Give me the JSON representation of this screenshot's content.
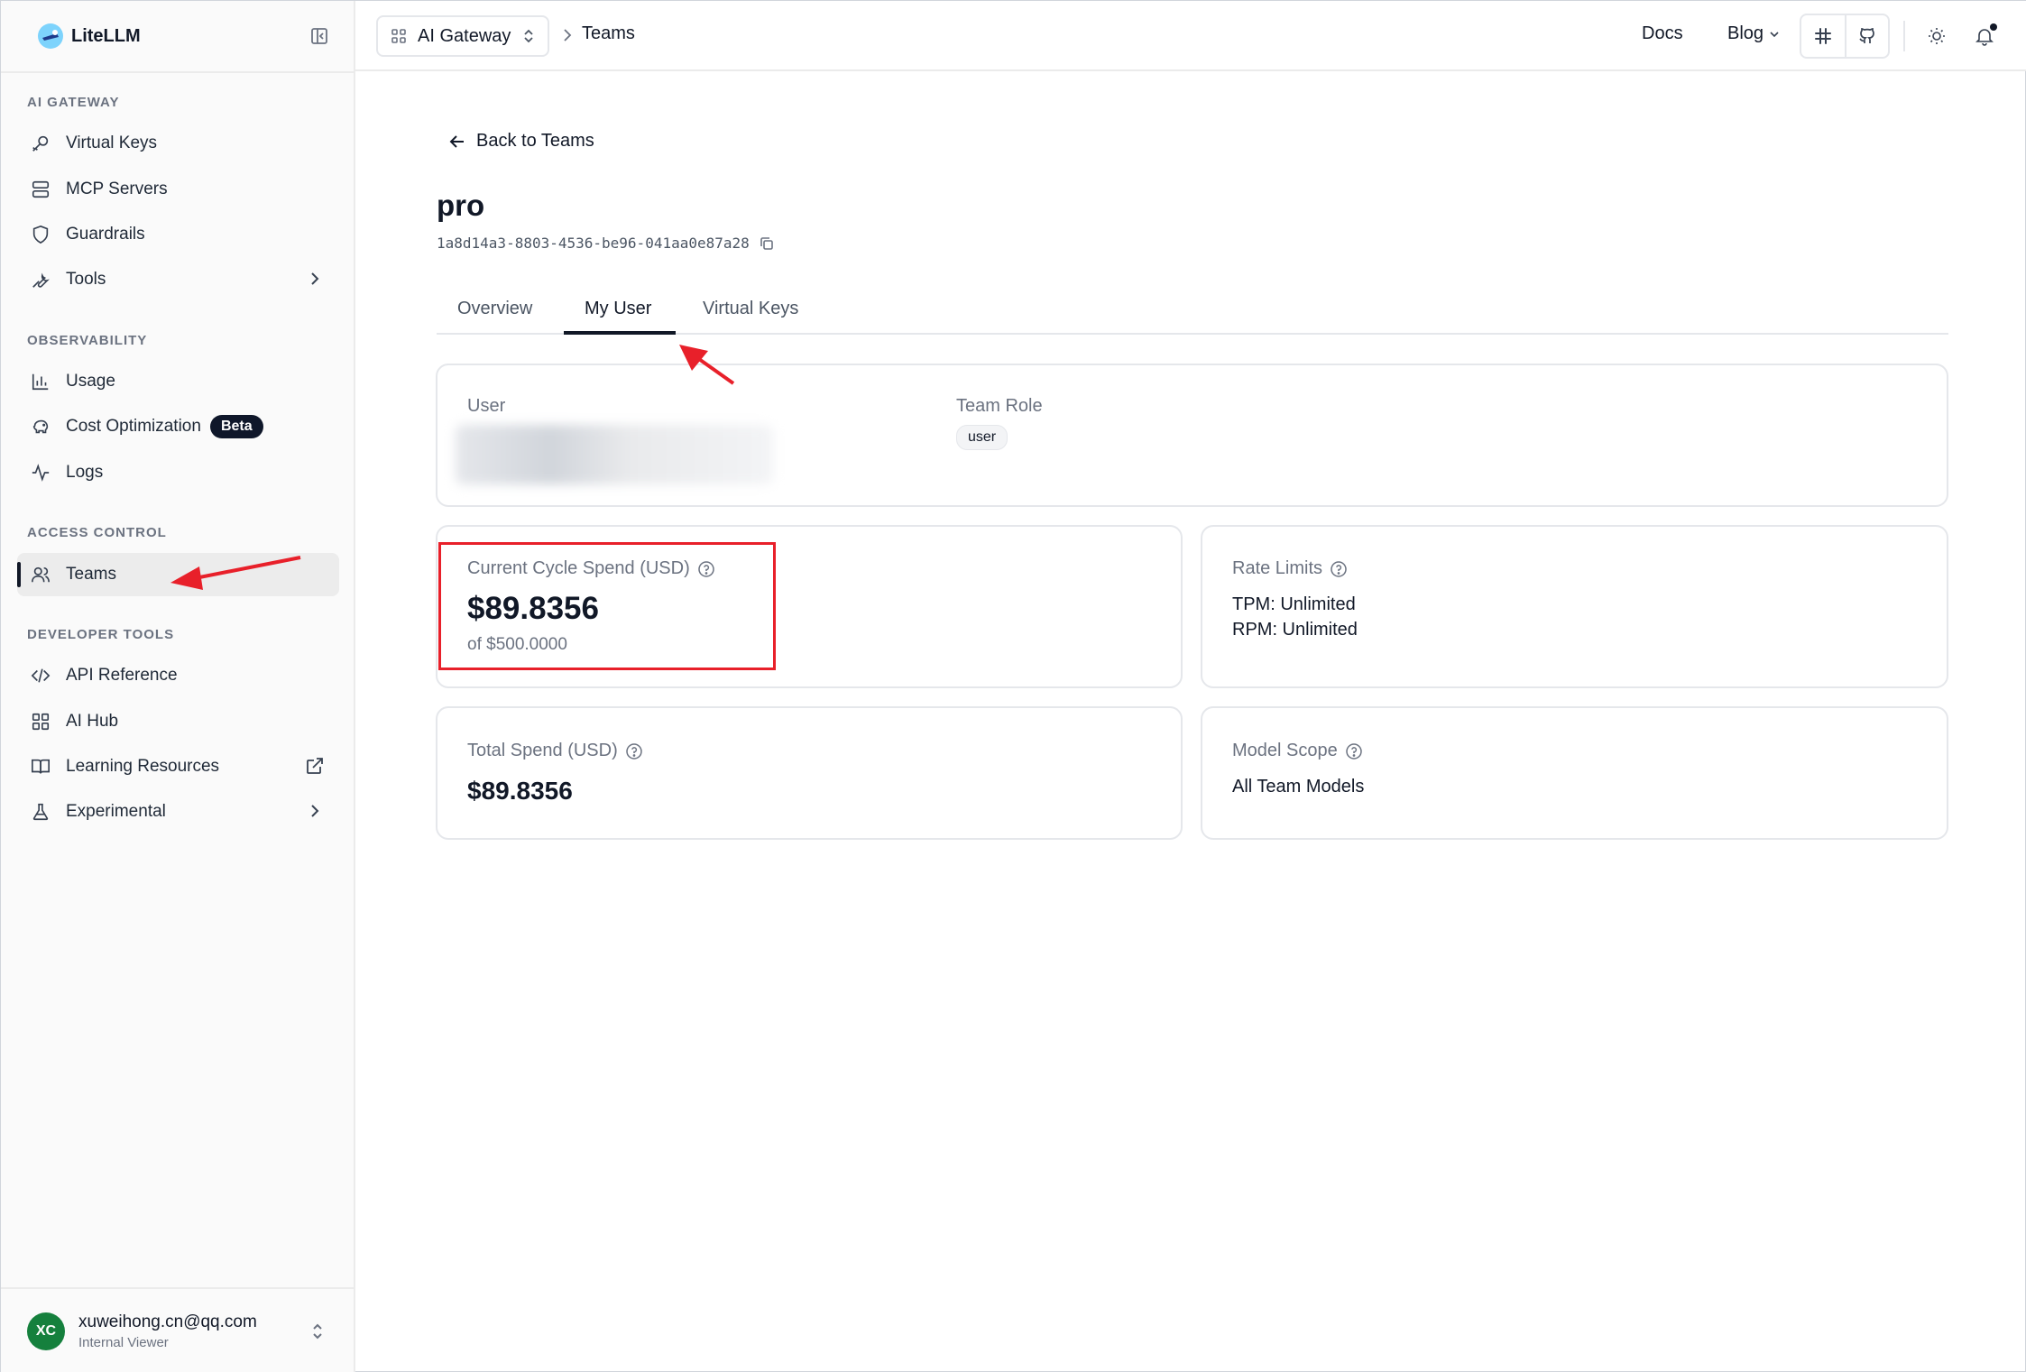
{
  "app": {
    "brand_name": "LiteLLM",
    "accent_color": "#111827",
    "annotation_color": "#e8202a"
  },
  "sidebar": {
    "sections": [
      {
        "label": "AI GATEWAY",
        "items": [
          {
            "label": "Virtual Keys",
            "icon": "key-icon"
          },
          {
            "label": "MCP Servers",
            "icon": "server-icon"
          },
          {
            "label": "Guardrails",
            "icon": "shield-icon"
          },
          {
            "label": "Tools",
            "icon": "wrench-icon"
          }
        ]
      },
      {
        "label": "OBSERVABILITY",
        "items": [
          {
            "label": "Usage",
            "icon": "bar-chart-icon"
          },
          {
            "label": "Cost Optimization",
            "icon": "piggy-bank-icon",
            "badge": "Beta"
          },
          {
            "label": "Logs",
            "icon": "activity-icon"
          }
        ]
      },
      {
        "label": "ACCESS CONTROL",
        "items": [
          {
            "label": "Teams",
            "icon": "users-icon",
            "active": true
          }
        ]
      },
      {
        "label": "DEVELOPER TOOLS",
        "items": [
          {
            "label": "API Reference",
            "icon": "code-icon"
          },
          {
            "label": "AI Hub",
            "icon": "grid-icon"
          },
          {
            "label": "Learning Resources",
            "icon": "book-icon"
          },
          {
            "label": "Experimental",
            "icon": "flask-icon"
          }
        ]
      }
    ],
    "user": {
      "initials": "XC",
      "email": "xuweihong.cn@qq.com",
      "role": "Internal Viewer"
    }
  },
  "topbar": {
    "gateway_label": "AI Gateway",
    "breadcrumb_current": "Teams",
    "docs_label": "Docs",
    "blog_label": "Blog"
  },
  "main": {
    "back_label": "Back to Teams",
    "team_name": "pro",
    "team_id": "1a8d14a3-8803-4536-be96-041aa0e87a28",
    "tabs": [
      "Overview",
      "My User",
      "Virtual Keys"
    ],
    "active_tab": "My User",
    "user_card": {
      "user_label": "User",
      "role_label": "Team Role",
      "role_value": "user"
    },
    "current_spend": {
      "label": "Current Cycle Spend (USD)",
      "value": "$89.8356",
      "limit": "of $500.0000"
    },
    "rate_limits": {
      "label": "Rate Limits",
      "tpm": "TPM: Unlimited",
      "rpm": "RPM: Unlimited"
    },
    "total_spend": {
      "label": "Total Spend (USD)",
      "value": "$89.8356"
    },
    "model_scope": {
      "label": "Model Scope",
      "value": "All Team Models"
    }
  }
}
